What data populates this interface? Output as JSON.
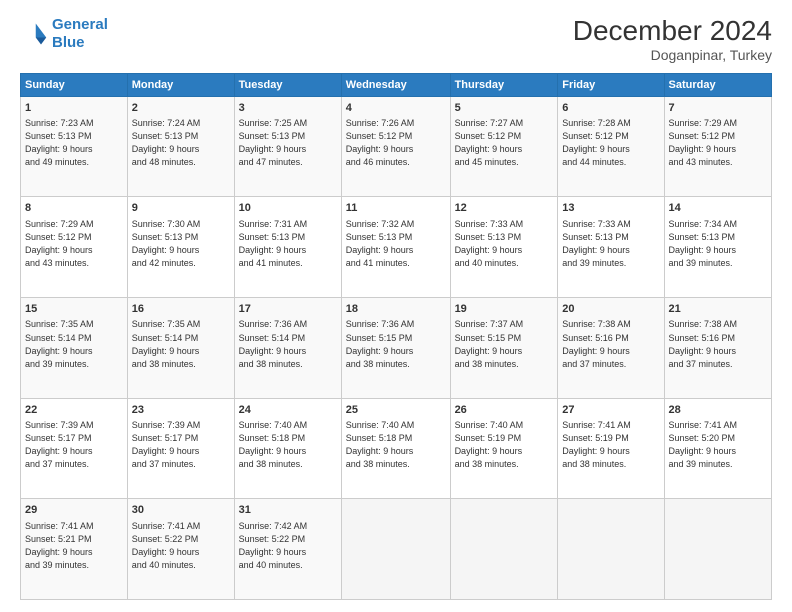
{
  "logo": {
    "line1": "General",
    "line2": "Blue"
  },
  "title": "December 2024",
  "subtitle": "Doganpinar, Turkey",
  "days_of_week": [
    "Sunday",
    "Monday",
    "Tuesday",
    "Wednesday",
    "Thursday",
    "Friday",
    "Saturday"
  ],
  "weeks": [
    [
      {
        "day": "1",
        "info": "Sunrise: 7:23 AM\nSunset: 5:13 PM\nDaylight: 9 hours\nand 49 minutes."
      },
      {
        "day": "2",
        "info": "Sunrise: 7:24 AM\nSunset: 5:13 PM\nDaylight: 9 hours\nand 48 minutes."
      },
      {
        "day": "3",
        "info": "Sunrise: 7:25 AM\nSunset: 5:13 PM\nDaylight: 9 hours\nand 47 minutes."
      },
      {
        "day": "4",
        "info": "Sunrise: 7:26 AM\nSunset: 5:12 PM\nDaylight: 9 hours\nand 46 minutes."
      },
      {
        "day": "5",
        "info": "Sunrise: 7:27 AM\nSunset: 5:12 PM\nDaylight: 9 hours\nand 45 minutes."
      },
      {
        "day": "6",
        "info": "Sunrise: 7:28 AM\nSunset: 5:12 PM\nDaylight: 9 hours\nand 44 minutes."
      },
      {
        "day": "7",
        "info": "Sunrise: 7:29 AM\nSunset: 5:12 PM\nDaylight: 9 hours\nand 43 minutes."
      }
    ],
    [
      {
        "day": "8",
        "info": "Sunrise: 7:29 AM\nSunset: 5:12 PM\nDaylight: 9 hours\nand 43 minutes."
      },
      {
        "day": "9",
        "info": "Sunrise: 7:30 AM\nSunset: 5:13 PM\nDaylight: 9 hours\nand 42 minutes."
      },
      {
        "day": "10",
        "info": "Sunrise: 7:31 AM\nSunset: 5:13 PM\nDaylight: 9 hours\nand 41 minutes."
      },
      {
        "day": "11",
        "info": "Sunrise: 7:32 AM\nSunset: 5:13 PM\nDaylight: 9 hours\nand 41 minutes."
      },
      {
        "day": "12",
        "info": "Sunrise: 7:33 AM\nSunset: 5:13 PM\nDaylight: 9 hours\nand 40 minutes."
      },
      {
        "day": "13",
        "info": "Sunrise: 7:33 AM\nSunset: 5:13 PM\nDaylight: 9 hours\nand 39 minutes."
      },
      {
        "day": "14",
        "info": "Sunrise: 7:34 AM\nSunset: 5:13 PM\nDaylight: 9 hours\nand 39 minutes."
      }
    ],
    [
      {
        "day": "15",
        "info": "Sunrise: 7:35 AM\nSunset: 5:14 PM\nDaylight: 9 hours\nand 39 minutes."
      },
      {
        "day": "16",
        "info": "Sunrise: 7:35 AM\nSunset: 5:14 PM\nDaylight: 9 hours\nand 38 minutes."
      },
      {
        "day": "17",
        "info": "Sunrise: 7:36 AM\nSunset: 5:14 PM\nDaylight: 9 hours\nand 38 minutes."
      },
      {
        "day": "18",
        "info": "Sunrise: 7:36 AM\nSunset: 5:15 PM\nDaylight: 9 hours\nand 38 minutes."
      },
      {
        "day": "19",
        "info": "Sunrise: 7:37 AM\nSunset: 5:15 PM\nDaylight: 9 hours\nand 38 minutes."
      },
      {
        "day": "20",
        "info": "Sunrise: 7:38 AM\nSunset: 5:16 PM\nDaylight: 9 hours\nand 37 minutes."
      },
      {
        "day": "21",
        "info": "Sunrise: 7:38 AM\nSunset: 5:16 PM\nDaylight: 9 hours\nand 37 minutes."
      }
    ],
    [
      {
        "day": "22",
        "info": "Sunrise: 7:39 AM\nSunset: 5:17 PM\nDaylight: 9 hours\nand 37 minutes."
      },
      {
        "day": "23",
        "info": "Sunrise: 7:39 AM\nSunset: 5:17 PM\nDaylight: 9 hours\nand 37 minutes."
      },
      {
        "day": "24",
        "info": "Sunrise: 7:40 AM\nSunset: 5:18 PM\nDaylight: 9 hours\nand 38 minutes."
      },
      {
        "day": "25",
        "info": "Sunrise: 7:40 AM\nSunset: 5:18 PM\nDaylight: 9 hours\nand 38 minutes."
      },
      {
        "day": "26",
        "info": "Sunrise: 7:40 AM\nSunset: 5:19 PM\nDaylight: 9 hours\nand 38 minutes."
      },
      {
        "day": "27",
        "info": "Sunrise: 7:41 AM\nSunset: 5:19 PM\nDaylight: 9 hours\nand 38 minutes."
      },
      {
        "day": "28",
        "info": "Sunrise: 7:41 AM\nSunset: 5:20 PM\nDaylight: 9 hours\nand 39 minutes."
      }
    ],
    [
      {
        "day": "29",
        "info": "Sunrise: 7:41 AM\nSunset: 5:21 PM\nDaylight: 9 hours\nand 39 minutes."
      },
      {
        "day": "30",
        "info": "Sunrise: 7:41 AM\nSunset: 5:22 PM\nDaylight: 9 hours\nand 40 minutes."
      },
      {
        "day": "31",
        "info": "Sunrise: 7:42 AM\nSunset: 5:22 PM\nDaylight: 9 hours\nand 40 minutes."
      },
      null,
      null,
      null,
      null
    ]
  ]
}
